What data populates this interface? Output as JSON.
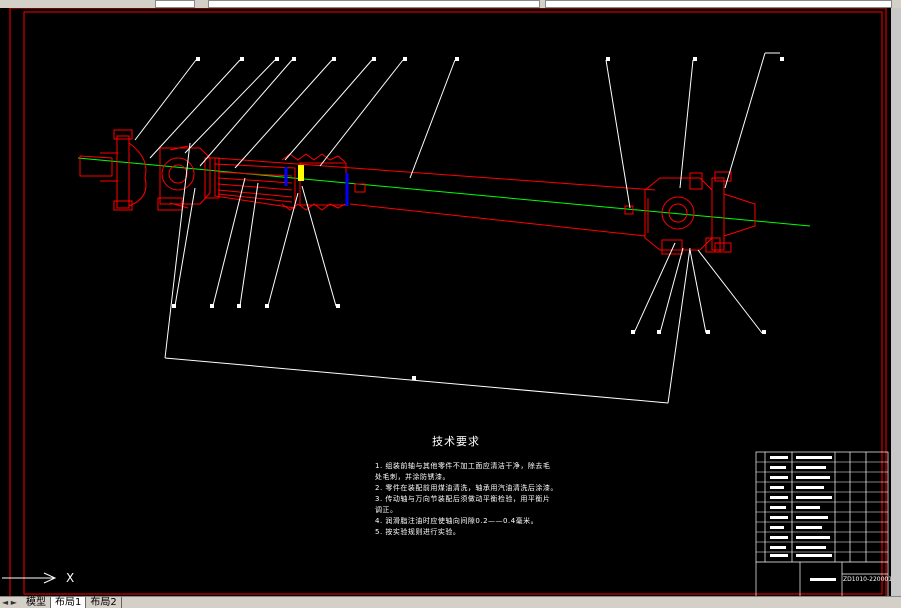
{
  "window": {
    "top_widgets": [
      "",
      "",
      ""
    ]
  },
  "layout_tabs": {
    "items": [
      "模型",
      "布局1",
      "布局2"
    ],
    "active_index": 1
  },
  "nav_arrows": "◄ ►",
  "ucs_icon": {
    "axis_x": "X"
  },
  "tech_requirements": {
    "title": "技术要求",
    "lines": [
      "1. 组装前轴与其他零件不加工面应清洁干净，除去毛",
      "处毛刺，并涂防锈漆。",
      "2. 零件在装配前用煤油清洗，轴承用汽油清洗后涂漆。",
      "3. 传动轴与万向节装配后须做动平衡检验，用平衡片",
      "调正。",
      "4. 润滑脂注油时应使轴向间隙0.2——0.4毫米。",
      "5. 按实验规则进行实验。"
    ]
  },
  "title_block": {
    "drawing_number": "ZD1010-2200015"
  },
  "colors": {
    "background": "#000000",
    "part_lines": "#ff0000",
    "center_line": "#00ff00",
    "leaders": "#ffffff",
    "accent_blue": "#0000ff",
    "accent_yellow": "#ffff00",
    "border": "#ff0000"
  }
}
